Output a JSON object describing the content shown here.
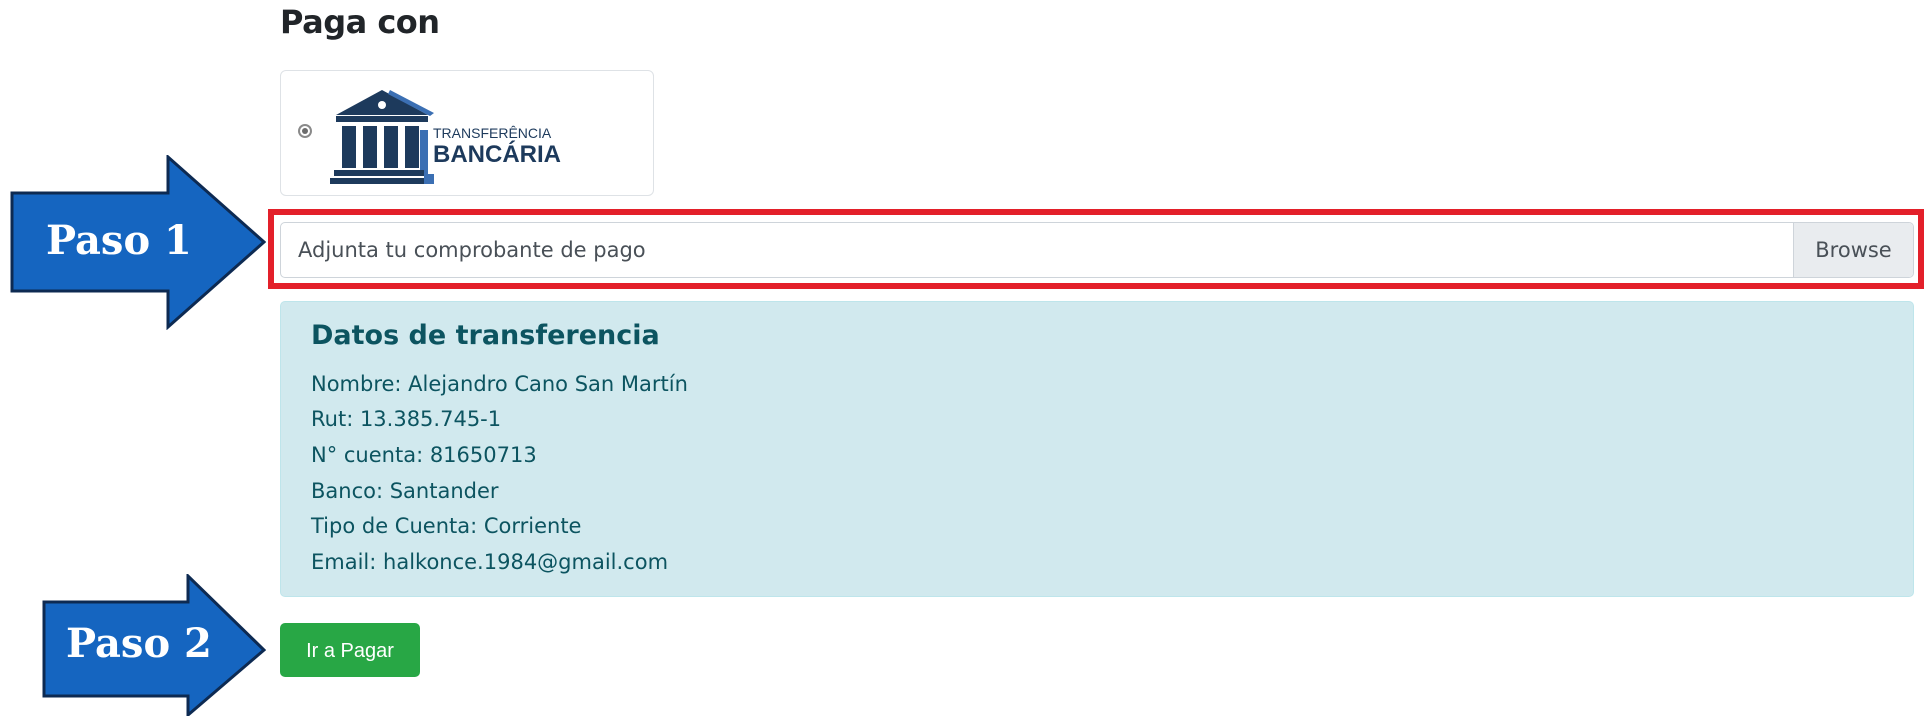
{
  "heading": "Paga con",
  "payment_method": {
    "label_top": "TRANSFERÊNCIA",
    "label_bottom": "BANCÁRIA",
    "icon": "bank-icon",
    "selected": true
  },
  "upload": {
    "placeholder": "Adjunta tu comprobante de pago",
    "browse_label": "Browse"
  },
  "transfer_info": {
    "title": "Datos de transferencia",
    "lines": [
      "Nombre: Alejandro Cano San Martín",
      "Rut: 13.385.745-1",
      "N° cuenta: 81650713",
      "Banco: Santander",
      "Tipo de Cuenta: Corriente",
      "Email: halkonce.1984@gmail.com"
    ]
  },
  "pay_button": "Ir a Pagar",
  "annotations": {
    "step1": "Paso 1",
    "step2": "Paso 2",
    "arrow_color": "#1565c0",
    "highlight_color": "#e3202a"
  }
}
